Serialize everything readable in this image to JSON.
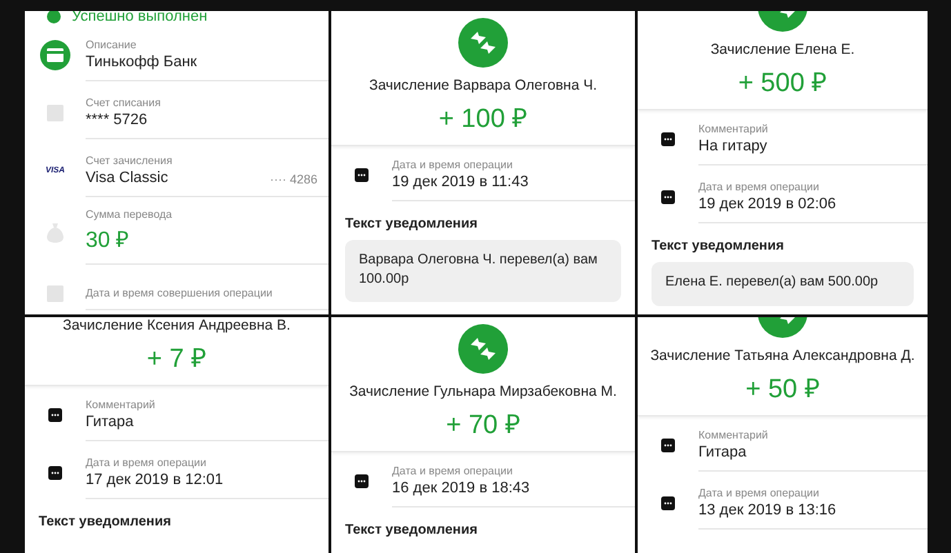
{
  "panels": [
    {
      "kind": "details",
      "status": {
        "text": "Успешно выполнен"
      },
      "fields": [
        {
          "kind": "card",
          "label": "Описание",
          "value": "Тинькофф Банк"
        },
        {
          "kind": "account",
          "label": "Счет списания",
          "value": "**** 5726"
        },
        {
          "kind": "visa",
          "logo_text": "VISA",
          "label": "Счет зачисления",
          "value": "Visa Classic",
          "extra": "···· 4286"
        },
        {
          "kind": "bag",
          "label": "Сумма перевода",
          "value": "30 ₽",
          "accent": true
        },
        {
          "kind": "account",
          "label": "Дата и время совершения операции"
        }
      ]
    },
    {
      "kind": "full",
      "header": {
        "title": "Зачисление Варвара Олеговна Ч.",
        "amount": "+ 100 ₽"
      },
      "fields": [
        {
          "kind": "dots",
          "label": "Дата и время операции",
          "value": "19 дек 2019 в 11:43"
        }
      ],
      "notice": {
        "heading": "Текст уведомления",
        "text": "Варвара Олеговна Ч. перевел(а) вам 100.00р"
      }
    },
    {
      "kind": "cropped",
      "header": {
        "title": "Зачисление Елена Е.",
        "amount": "+ 500 ₽"
      },
      "fields": [
        {
          "kind": "dots",
          "label": "Комментарий",
          "value": "На гитару"
        },
        {
          "kind": "dots",
          "label": "Дата и время операции",
          "value": "19 дек 2019 в 02:06"
        }
      ],
      "notice": {
        "heading": "Текст уведомления",
        "text": "Елена Е. перевел(а) вам 500.00р"
      }
    },
    {
      "kind": "title-only",
      "header": {
        "title": "Зачисление Ксения Андреевна В.",
        "amount": "+ 7 ₽"
      },
      "fields": [
        {
          "kind": "dots",
          "label": "Комментарий",
          "value": "Гитара"
        },
        {
          "kind": "dots",
          "label": "Дата и время операции",
          "value": "17 дек 2019 в 12:01"
        }
      ],
      "notice": {
        "heading": "Текст уведомления"
      }
    },
    {
      "kind": "full",
      "header": {
        "title": "Зачисление Гульнара Мирзабековна М.",
        "amount": "+ 70 ₽"
      },
      "fields": [
        {
          "kind": "dots",
          "label": "Дата и время операции",
          "value": "16 дек 2019 в 18:43"
        }
      ],
      "notice": {
        "heading": "Текст уведомления"
      }
    },
    {
      "kind": "cropped",
      "header": {
        "title": "Зачисление Татьяна Александровна Д.",
        "amount": "+ 50 ₽"
      },
      "fields": [
        {
          "kind": "dots",
          "label": "Комментарий",
          "value": "Гитара"
        },
        {
          "kind": "dots",
          "label": "Дата и время операции",
          "value": "13 дек 2019 в 13:16"
        }
      ]
    }
  ]
}
